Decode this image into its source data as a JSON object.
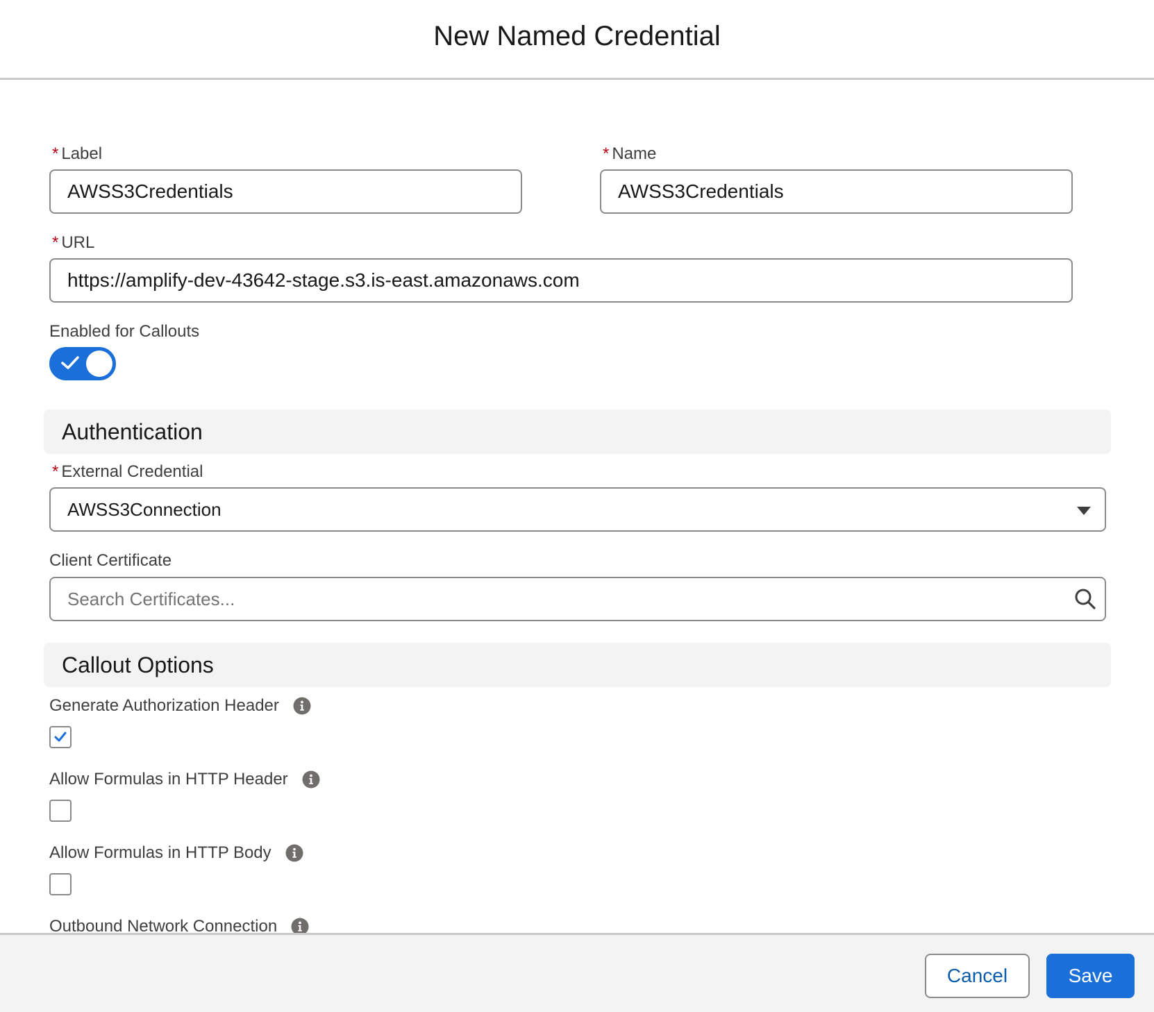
{
  "modal": {
    "title": "New Named Credential"
  },
  "required_marker": "*",
  "fields": {
    "label": {
      "label": "Label",
      "value": "AWSS3Credentials"
    },
    "name": {
      "label": "Name",
      "value": "AWSS3Credentials"
    },
    "url": {
      "label": "URL",
      "value": "https://amplify-dev-43642-stage.s3.is-east.amazonaws.com"
    },
    "enabled_for_callouts": {
      "label": "Enabled for Callouts",
      "checked": true
    }
  },
  "authentication": {
    "section_title": "Authentication",
    "external_credential": {
      "label": "External Credential",
      "value": "AWSS3Connection"
    },
    "client_certificate": {
      "label": "Client Certificate",
      "placeholder": "Search Certificates..."
    }
  },
  "callout_options": {
    "section_title": "Callout Options",
    "generate_auth_header": {
      "label": "Generate Authorization Header",
      "checked": true
    },
    "allow_formulas_header": {
      "label": "Allow Formulas in HTTP Header",
      "checked": false
    },
    "allow_formulas_body": {
      "label": "Allow Formulas in HTTP Body",
      "checked": false
    },
    "outbound_network_connection": {
      "label": "Outbound Network Connection"
    }
  },
  "footer": {
    "cancel_label": "Cancel",
    "save_label": "Save"
  },
  "icons": {
    "toggle_check": "check-icon",
    "select_caret": "caret-down-icon",
    "search": "search-icon",
    "info": "info-icon",
    "checkbox_check": "check-icon"
  },
  "colors": {
    "brand_blue": "#1b6fd8",
    "link_blue": "#0b5cab",
    "required_red": "#ba0517",
    "section_bg": "#f3f3f3",
    "border_gray": "#8a8a8a"
  }
}
